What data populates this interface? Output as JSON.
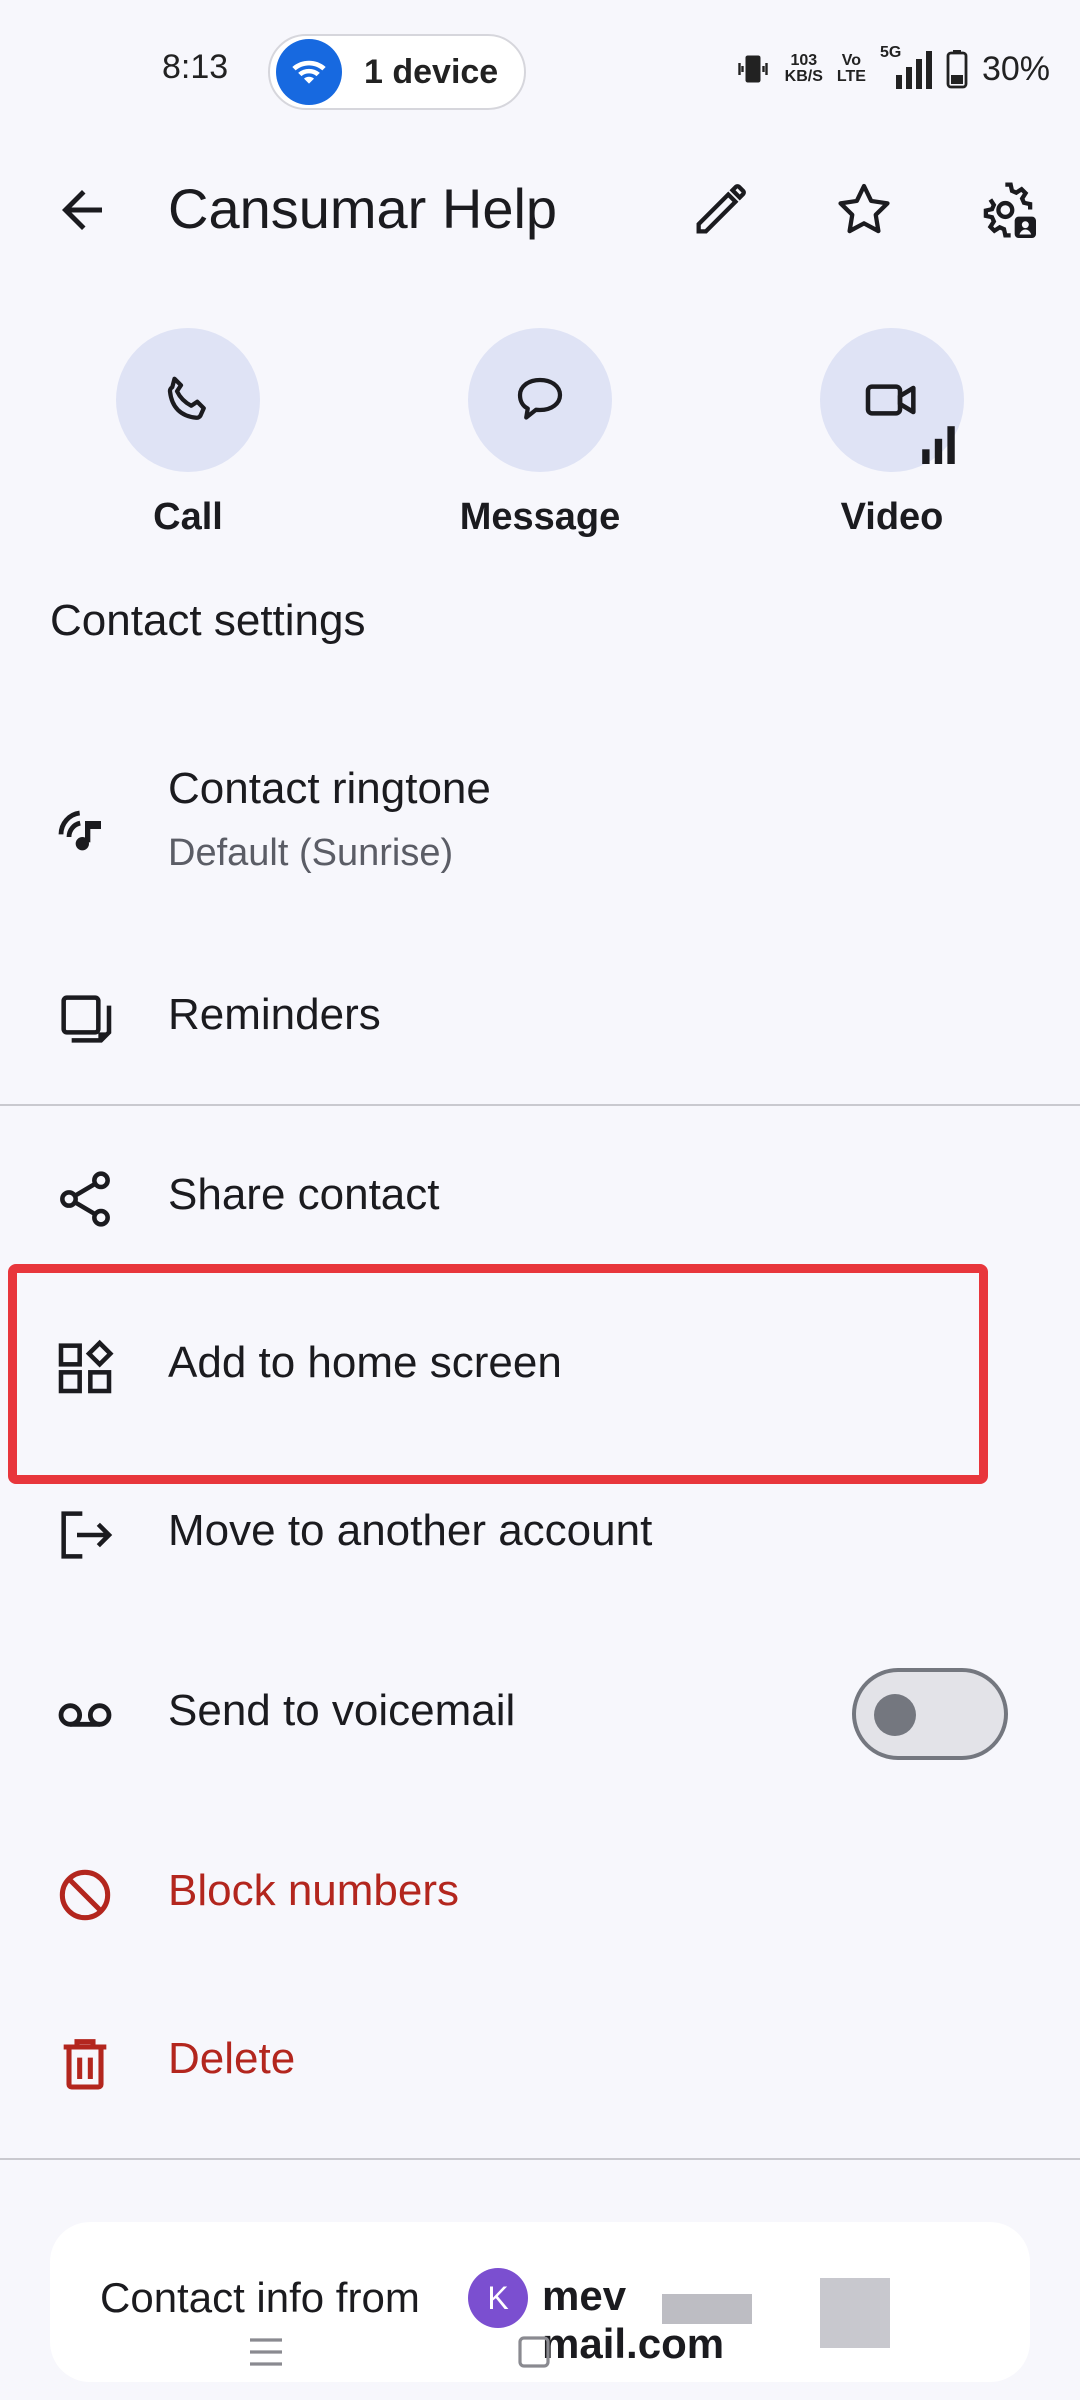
{
  "status_bar": {
    "time": "8:13",
    "device_pill_label": "1 device",
    "net_speed_value": "103",
    "net_speed_unit": "KB/S",
    "volte_top": "Vo",
    "volte_bottom": "LTE",
    "network_type": "5G",
    "battery": "30%"
  },
  "app_bar": {
    "title": "Cansumar Help"
  },
  "quick_actions": [
    {
      "label": "Call"
    },
    {
      "label": "Message"
    },
    {
      "label": "Video"
    }
  ],
  "contact_settings": {
    "section_title": "Contact settings",
    "ringtone_label": "Contact ringtone",
    "ringtone_value": "Default (Sunrise)",
    "reminders_label": "Reminders"
  },
  "menu": {
    "share": "Share contact",
    "add_home": "Add to home screen",
    "move_account": "Move to another account",
    "voicemail": "Send to voicemail",
    "block": "Block numbers",
    "delete": "Delete"
  },
  "footer": {
    "contact_info_from": "Contact info from",
    "avatar_letter": "K",
    "email_start": "mev",
    "email_end": "mail.com"
  },
  "colors": {
    "accent_circle": "#dfe3f5",
    "destructive": "#b3261e",
    "highlight_box": "#e8363c",
    "device_pill_icon": "#1769e0"
  }
}
